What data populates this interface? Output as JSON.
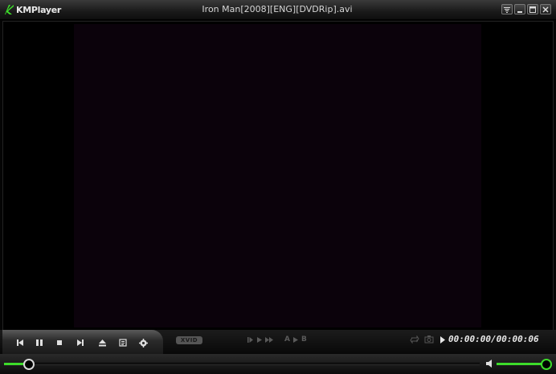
{
  "app": {
    "logo_text": "KMPlayer",
    "window_title": "Iron Man[2008][ENG][DVDRip].avi",
    "accent_color": "#3ddc2a"
  },
  "window_controls": [
    "menu-icon",
    "minimize-icon",
    "maximize-icon",
    "close-icon"
  ],
  "controls": {
    "buttons": [
      "previous-icon",
      "pause-icon",
      "stop-icon",
      "next-icon",
      "eject-icon",
      "playlist-icon",
      "settings-icon"
    ],
    "codec_badge": "XVID",
    "ab_repeat": {
      "a": "A",
      "b": "B"
    }
  },
  "playback": {
    "time_display": "00:00:00/00:00:06",
    "seek_progress": 0.05,
    "volume_level": 0.95
  }
}
